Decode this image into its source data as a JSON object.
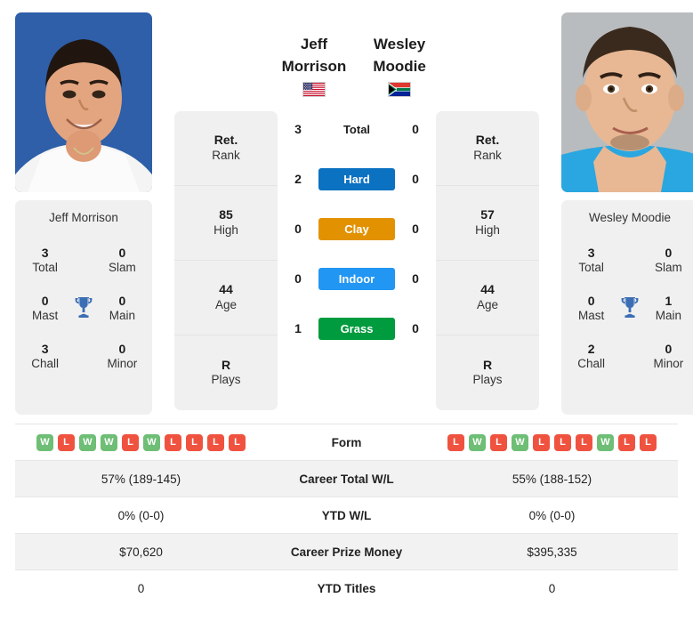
{
  "players": {
    "left": {
      "name": "Jeff Morrison",
      "name_lines": [
        "Jeff Morrison"
      ],
      "card_name": "Jeff Morrison",
      "flag": "us-flag-icon",
      "flag_country": "United States",
      "rank": {
        "value": "Ret.",
        "label": "Rank"
      },
      "high": {
        "value": "85",
        "label": "High"
      },
      "age": {
        "value": "44",
        "label": "Age"
      },
      "plays": {
        "value": "R",
        "label": "Plays"
      },
      "titles": [
        {
          "value": "3",
          "label": "Total"
        },
        {
          "value": "0",
          "label": "Slam"
        },
        {
          "value": "0",
          "label": "Mast"
        },
        {
          "value": "0",
          "label": "Main"
        },
        {
          "value": "3",
          "label": "Chall"
        },
        {
          "value": "0",
          "label": "Minor"
        }
      ],
      "form": [
        "W",
        "L",
        "W",
        "W",
        "L",
        "W",
        "L",
        "L",
        "L",
        "L"
      ],
      "career_total_wl": "57% (189-145)",
      "ytd_wl": "0% (0-0)",
      "career_prize_money": "$70,620",
      "ytd_titles": "0"
    },
    "right": {
      "name": "Wesley Moodie",
      "name_lines": [
        "Wesley",
        "Moodie"
      ],
      "card_name": "Wesley Moodie",
      "flag": "za-flag-icon",
      "flag_country": "South Africa",
      "rank": {
        "value": "Ret.",
        "label": "Rank"
      },
      "high": {
        "value": "57",
        "label": "High"
      },
      "age": {
        "value": "44",
        "label": "Age"
      },
      "plays": {
        "value": "R",
        "label": "Plays"
      },
      "titles": [
        {
          "value": "3",
          "label": "Total"
        },
        {
          "value": "0",
          "label": "Slam"
        },
        {
          "value": "0",
          "label": "Mast"
        },
        {
          "value": "1",
          "label": "Main"
        },
        {
          "value": "2",
          "label": "Chall"
        },
        {
          "value": "0",
          "label": "Minor"
        }
      ],
      "form": [
        "L",
        "W",
        "L",
        "W",
        "L",
        "L",
        "L",
        "W",
        "L",
        "L"
      ],
      "career_total_wl": "55% (188-152)",
      "ytd_wl": "0% (0-0)",
      "career_prize_money": "$395,335",
      "ytd_titles": "0"
    }
  },
  "surfaces": [
    {
      "key": "total",
      "label": "Total",
      "left": "3",
      "right": "0",
      "color": "transparent",
      "text_color": "#1c1c1c"
    },
    {
      "key": "hard",
      "label": "Hard",
      "left": "2",
      "right": "0",
      "color": "#0b71c1",
      "text_color": "#ffffff"
    },
    {
      "key": "clay",
      "label": "Clay",
      "left": "0",
      "right": "0",
      "color": "#e29200",
      "text_color": "#ffffff"
    },
    {
      "key": "indoor",
      "label": "Indoor",
      "left": "0",
      "right": "0",
      "color": "#2196f3",
      "text_color": "#ffffff"
    },
    {
      "key": "grass",
      "label": "Grass",
      "left": "1",
      "right": "0",
      "color": "#009b3e",
      "text_color": "#ffffff"
    }
  ],
  "table_rows": [
    {
      "key": "form",
      "label": "Form"
    },
    {
      "key": "career_total_wl",
      "label": "Career Total W/L"
    },
    {
      "key": "ytd_wl",
      "label": "YTD W/L"
    },
    {
      "key": "career_prize_money",
      "label": "Career Prize Money"
    },
    {
      "key": "ytd_titles",
      "label": "YTD Titles"
    }
  ],
  "icons": {
    "trophy": "trophy-icon",
    "trophy_color": "#3c6eb4"
  },
  "colors": {
    "card_bg": "#f0f0f0",
    "row_shaded": "#f2f2f2",
    "win": "#6ebe76",
    "loss": "#ef5340"
  }
}
